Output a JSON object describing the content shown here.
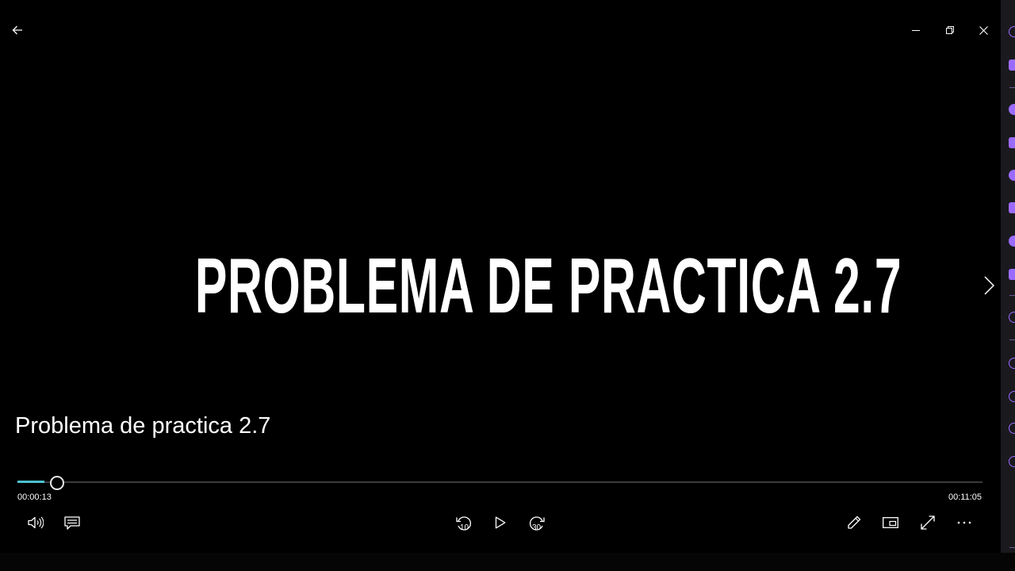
{
  "video": {
    "title_card": "PROBLEMA DE PRACTICA  2.7",
    "media_name": "Problema de practica 2.7"
  },
  "playback": {
    "current_time": "00:00:13",
    "total_time": "00:11:05",
    "progress_fraction": 0.0196,
    "skip_back_label": "10",
    "skip_forward_label": "30"
  },
  "icons": {
    "back": "back-arrow-icon",
    "minimize": "minimize-icon",
    "restore": "restore-icon",
    "close": "close-icon",
    "next": "chevron-right-icon",
    "volume": "volume-icon",
    "captions": "captions-icon",
    "skip_back": "skip-back-10-icon",
    "play": "play-icon",
    "skip_forward": "skip-forward-30-icon",
    "edit": "pencil-icon",
    "mini_view": "mini-view-icon",
    "fullscreen": "fullscreen-icon",
    "more": "more-icon"
  },
  "colors": {
    "accent": "#4cc2cf",
    "side_icons": "#9b6bff"
  }
}
